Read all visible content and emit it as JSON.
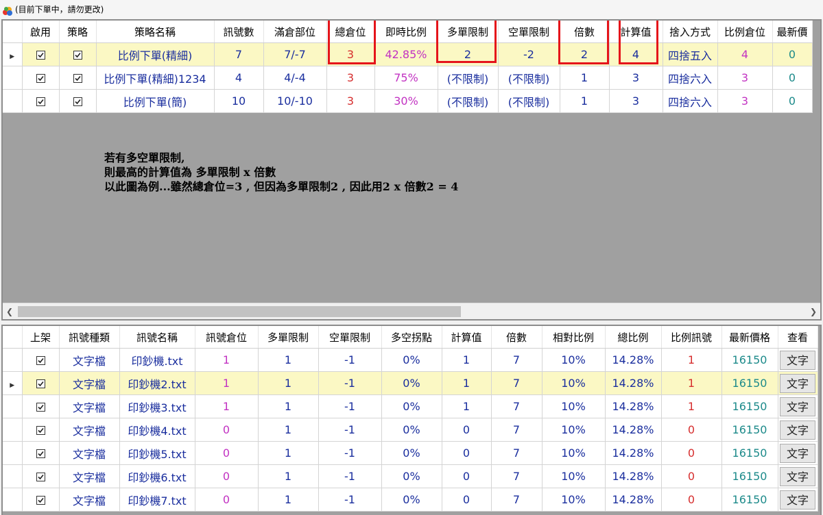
{
  "window": {
    "title": "(目前下單中，請勿更改)"
  },
  "strategy_grid": {
    "columns": [
      "啟用",
      "策略",
      "策略名稱",
      "訊號數",
      "滿倉部位",
      "總倉位",
      "即時比例",
      "多單限制",
      "空單限制",
      "倍數",
      "計算值",
      "捨入方式",
      "比例倉位",
      "最新價"
    ],
    "rows": [
      {
        "selected": true,
        "enabled": true,
        "strategy": true,
        "name": "比例下單(精細)",
        "signal_count": "7",
        "full_position": "7/-7",
        "total_position": "3",
        "realtime_ratio": "42.85%",
        "long_limit": "2",
        "short_limit": "-2",
        "multiplier": "2",
        "calc_value": "4",
        "rounding": "四捨五入",
        "ratio_position": "4",
        "latest": "0"
      },
      {
        "selected": false,
        "enabled": true,
        "strategy": true,
        "name": "比例下單(精細)1234",
        "signal_count": "4",
        "full_position": "4/-4",
        "total_position": "3",
        "realtime_ratio": "75%",
        "long_limit": "(不限制)",
        "short_limit": "(不限制)",
        "multiplier": "1",
        "calc_value": "3",
        "rounding": "四捨六入",
        "ratio_position": "3",
        "latest": "0"
      },
      {
        "selected": false,
        "enabled": true,
        "strategy": true,
        "name": "比例下單(簡)",
        "signal_count": "10",
        "full_position": "10/-10",
        "total_position": "3",
        "realtime_ratio": "30%",
        "long_limit": "(不限制)",
        "short_limit": "(不限制)",
        "multiplier": "1",
        "calc_value": "3",
        "rounding": "四捨六入",
        "ratio_position": "3",
        "latest": "0"
      }
    ]
  },
  "annotation": {
    "line1": "若有多空單限制,",
    "line2": "則最高的計算值為 多單限制 x 倍數",
    "line3": "以此圖為例...雖然總倉位=3 , 但因為多單限制2 , 因此用2 x 倍數2 = 4"
  },
  "signal_grid": {
    "columns": [
      "上架",
      "訊號種類",
      "訊號名稱",
      "訊號倉位",
      "多單限制",
      "空單限制",
      "多空拐點",
      "計算值",
      "倍數",
      "相對比例",
      "總比例",
      "比例訊號",
      "最新價格",
      "查看"
    ],
    "rows": [
      {
        "selected": false,
        "listed": true,
        "type": "文字檔",
        "name": "印鈔機.txt",
        "position": "1",
        "long_limit": "1",
        "short_limit": "-1",
        "pivot": "0%",
        "calc": "1",
        "multiplier": "7",
        "relative_ratio": "10%",
        "total_ratio": "14.28%",
        "ratio_signal": "1",
        "latest_price": "16150",
        "view": "文字"
      },
      {
        "selected": true,
        "listed": true,
        "type": "文字檔",
        "name": "印鈔機2.txt",
        "position": "1",
        "long_limit": "1",
        "short_limit": "-1",
        "pivot": "0%",
        "calc": "1",
        "multiplier": "7",
        "relative_ratio": "10%",
        "total_ratio": "14.28%",
        "ratio_signal": "1",
        "latest_price": "16150",
        "view": "文字"
      },
      {
        "selected": false,
        "listed": true,
        "type": "文字檔",
        "name": "印鈔機3.txt",
        "position": "1",
        "long_limit": "1",
        "short_limit": "-1",
        "pivot": "0%",
        "calc": "1",
        "multiplier": "7",
        "relative_ratio": "10%",
        "total_ratio": "14.28%",
        "ratio_signal": "1",
        "latest_price": "16150",
        "view": "文字"
      },
      {
        "selected": false,
        "listed": true,
        "type": "文字檔",
        "name": "印鈔機4.txt",
        "position": "0",
        "long_limit": "1",
        "short_limit": "-1",
        "pivot": "0%",
        "calc": "0",
        "multiplier": "7",
        "relative_ratio": "10%",
        "total_ratio": "14.28%",
        "ratio_signal": "0",
        "latest_price": "16150",
        "view": "文字"
      },
      {
        "selected": false,
        "listed": true,
        "type": "文字檔",
        "name": "印鈔機5.txt",
        "position": "0",
        "long_limit": "1",
        "short_limit": "-1",
        "pivot": "0%",
        "calc": "0",
        "multiplier": "7",
        "relative_ratio": "10%",
        "total_ratio": "14.28%",
        "ratio_signal": "0",
        "latest_price": "16150",
        "view": "文字"
      },
      {
        "selected": false,
        "listed": true,
        "type": "文字檔",
        "name": "印鈔機6.txt",
        "position": "0",
        "long_limit": "1",
        "short_limit": "-1",
        "pivot": "0%",
        "calc": "0",
        "multiplier": "7",
        "relative_ratio": "10%",
        "total_ratio": "14.28%",
        "ratio_signal": "0",
        "latest_price": "16150",
        "view": "文字"
      },
      {
        "selected": false,
        "listed": true,
        "type": "文字檔",
        "name": "印鈔機7.txt",
        "position": "0",
        "long_limit": "1",
        "short_limit": "-1",
        "pivot": "0%",
        "calc": "0",
        "multiplier": "7",
        "relative_ratio": "10%",
        "total_ratio": "14.28%",
        "ratio_signal": "0",
        "latest_price": "16150",
        "view": "文字"
      }
    ]
  },
  "colors": {
    "highlight_box": "#e5141a",
    "selected_row": "#fbf8c4",
    "text_blue": "#1a2e9e",
    "text_red": "#d62e2e",
    "text_magenta": "#c232c2",
    "text_teal": "#1c8a8a"
  }
}
